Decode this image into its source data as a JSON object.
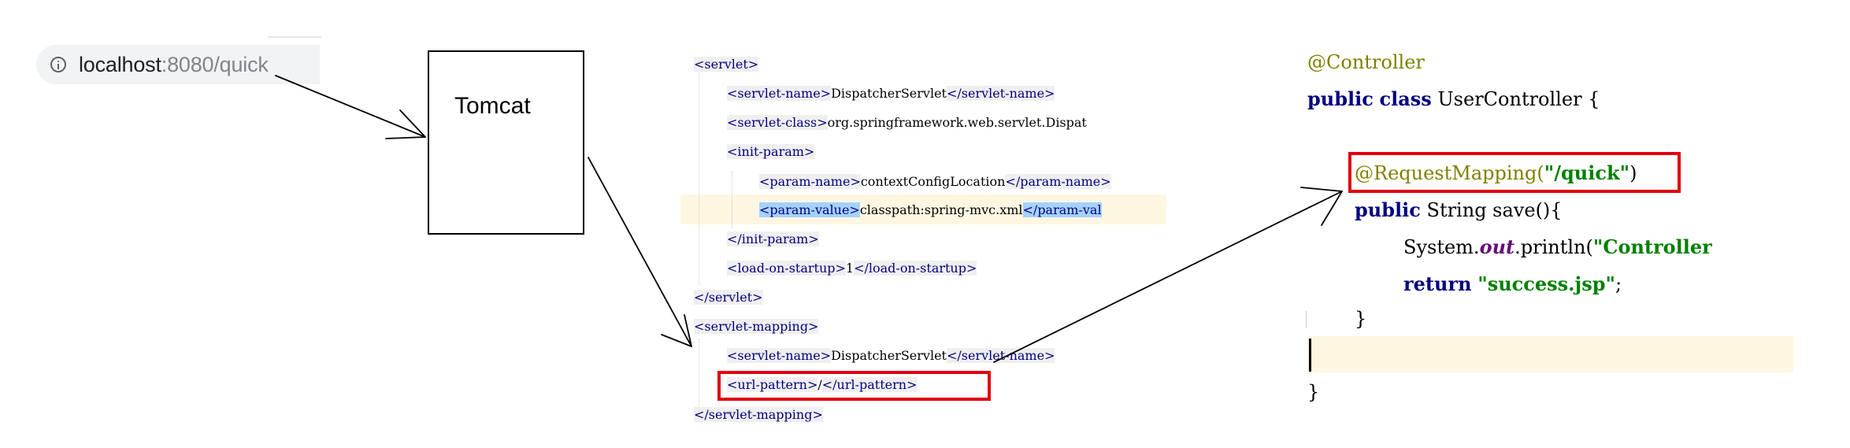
{
  "browser": {
    "address_host": "localhost",
    "address_path": ":8080/quick"
  },
  "server_box": {
    "label": "Tomcat"
  },
  "web_xml": {
    "servlet_open": "<servlet>",
    "servlet_name_open": "<servlet-name>",
    "servlet_name_value": "DispatcherServlet",
    "servlet_name_close": "</servlet-name>",
    "servlet_class_open": "<servlet-class>",
    "servlet_class_value": "org.springframework.web.servlet.Dispat",
    "init_param_open": "<init-param>",
    "param_name_open": "<param-name>",
    "param_name_value": "contextConfigLocation",
    "param_name_close": "</param-name>",
    "param_value_open": "<param-value>",
    "param_value_value": "classpath:spring-mvc.xml",
    "param_value_close": "</param-val",
    "init_param_close": "</init-param>",
    "load_on_startup_open": "<load-on-startup>",
    "load_on_startup_value": "1",
    "load_on_startup_close": "</load-on-startup>",
    "servlet_close": "</servlet>",
    "mapping_open": "<servlet-mapping>",
    "mapping_name_open": "<servlet-name>",
    "mapping_name_value": "DispatcherServlet",
    "mapping_name_close": "</servlet-name>",
    "url_pattern_open": "<url-pattern>",
    "url_pattern_value": "/",
    "url_pattern_close": "</url-pattern>",
    "mapping_close": "</servlet-mapping>"
  },
  "controller": {
    "annotation": "@Controller",
    "kw_public": "public",
    "kw_class": "class",
    "class_name": "UserController {",
    "request_mapping_name": "@RequestMapping(",
    "request_mapping_value": "\"/quick\"",
    "request_mapping_close": ")",
    "method_public": "public",
    "method_signature": "String save(){",
    "system": "System.",
    "out_field": "out",
    "println": ".println(",
    "println_arg": "\"Controller",
    "kw_return": "return",
    "return_value": "\"success.jsp\"",
    "semicolon": ";",
    "method_close": "}",
    "class_close": "}"
  },
  "colors": {
    "highlight_red": "#e1000f",
    "annotation": "#808000",
    "keyword": "#000080",
    "string": "#008000",
    "static_field": "#660e7a"
  }
}
